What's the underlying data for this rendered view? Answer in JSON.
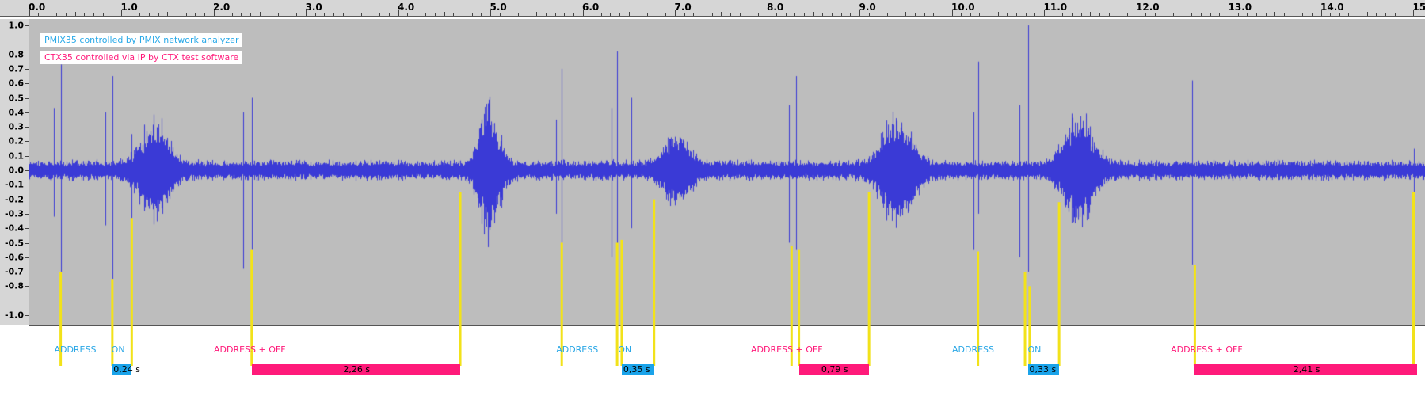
{
  "ruler": {
    "ticks": [
      "0.0",
      "1.0",
      "2.0",
      "3.0",
      "4.0",
      "5.0",
      "6.0",
      "7.0",
      "8.0",
      "9.0",
      "10.0",
      "11.0",
      "12.0",
      "13.0",
      "14.0",
      "15.0"
    ]
  },
  "amplitude_axis": {
    "labels": [
      "1.0",
      "0.8",
      "0.7",
      "0.6",
      "0.5",
      "0.4",
      "0.3",
      "0.2",
      "0.1",
      "0.0",
      "-0.1",
      "-0.2",
      "-0.3",
      "-0.4",
      "-0.5",
      "-0.6",
      "-0.7",
      "-0.8",
      "-1.0"
    ]
  },
  "legend": {
    "blue": "PMIX35 controlled by PMIX network analyzer",
    "pink": "CTX35 controlled via IP by CTX test software"
  },
  "colors": {
    "waveform": "#3a3ad6",
    "marker": "#f2e21a",
    "blue": "#1aa3ea",
    "pink": "#ff1a7a",
    "track": "#bdbdbd"
  },
  "annotations": [
    {
      "text": "ADDRESS",
      "color": "blue",
      "time": 0.27
    },
    {
      "text": "ON",
      "color": "blue",
      "time": 0.89
    },
    {
      "text": "ADDRESS + OFF",
      "color": "pink",
      "time": 2.0
    },
    {
      "text": "ADDRESS",
      "color": "blue",
      "time": 5.71
    },
    {
      "text": "ON",
      "color": "blue",
      "time": 6.38
    },
    {
      "text": "ADDRESS + OFF",
      "color": "pink",
      "time": 7.82
    },
    {
      "text": "ADDRESS",
      "color": "blue",
      "time": 10.0
    },
    {
      "text": "ON",
      "color": "blue",
      "time": 10.82
    },
    {
      "text": "ADDRESS + OFF",
      "color": "pink",
      "time": 12.37
    }
  ],
  "durations": [
    {
      "text": "0,24 s",
      "color": "blue",
      "start": 0.895,
      "end": 1.1
    },
    {
      "text": "2,26 s",
      "color": "pink",
      "start": 2.41,
      "end": 4.67
    },
    {
      "text": "0,35 s",
      "color": "blue",
      "start": 6.42,
      "end": 6.77
    },
    {
      "text": "0,79 s",
      "color": "pink",
      "start": 8.34,
      "end": 9.1
    },
    {
      "text": "0,33 s",
      "color": "blue",
      "start": 10.82,
      "end": 11.16
    },
    {
      "text": "2,41 s",
      "color": "pink",
      "start": 12.63,
      "end": 15.04
    }
  ],
  "markers": [
    {
      "time": 0.34,
      "amp": -0.7
    },
    {
      "time": 0.9,
      "amp": -0.75
    },
    {
      "time": 1.11,
      "amp": -0.33
    },
    {
      "time": 2.41,
      "amp": -0.55
    },
    {
      "time": 4.67,
      "amp": -0.15
    },
    {
      "time": 5.77,
      "amp": -0.5
    },
    {
      "time": 6.37,
      "amp": -0.5
    },
    {
      "time": 6.42,
      "amp": -0.48
    },
    {
      "time": 6.77,
      "amp": -0.2
    },
    {
      "time": 8.26,
      "amp": -0.52
    },
    {
      "time": 8.34,
      "amp": -0.55
    },
    {
      "time": 9.1,
      "amp": -0.15
    },
    {
      "time": 10.28,
      "amp": -0.56
    },
    {
      "time": 10.79,
      "amp": -0.7
    },
    {
      "time": 10.84,
      "amp": -0.8
    },
    {
      "time": 11.16,
      "amp": -0.22
    },
    {
      "time": 12.63,
      "amp": -0.65
    },
    {
      "time": 15.0,
      "amp": -0.15
    }
  ],
  "spikes": [
    {
      "time": 0.27,
      "pos": 0.43,
      "neg": 0.32
    },
    {
      "time": 0.34,
      "pos": 0.73,
      "neg": 0.7
    },
    {
      "time": 0.82,
      "pos": 0.4,
      "neg": 0.38
    },
    {
      "time": 0.9,
      "pos": 0.65,
      "neg": 0.75
    },
    {
      "time": 1.11,
      "pos": 0.25,
      "neg": 0.33
    },
    {
      "time": 2.32,
      "pos": 0.4,
      "neg": 0.68
    },
    {
      "time": 2.41,
      "pos": 0.5,
      "neg": 0.55
    },
    {
      "time": 5.71,
      "pos": 0.35,
      "neg": 0.3
    },
    {
      "time": 5.77,
      "pos": 0.7,
      "neg": 0.5
    },
    {
      "time": 6.31,
      "pos": 0.43,
      "neg": 0.6
    },
    {
      "time": 6.37,
      "pos": 0.82,
      "neg": 0.65
    },
    {
      "time": 6.52,
      "pos": 0.5,
      "neg": 0.4
    },
    {
      "time": 8.23,
      "pos": 0.45,
      "neg": 0.5
    },
    {
      "time": 8.31,
      "pos": 0.65,
      "neg": 0.55
    },
    {
      "time": 10.23,
      "pos": 0.4,
      "neg": 0.55
    },
    {
      "time": 10.28,
      "pos": 0.75,
      "neg": 0.3
    },
    {
      "time": 10.73,
      "pos": 0.45,
      "neg": 0.6
    },
    {
      "time": 10.82,
      "pos": 1.0,
      "neg": 0.7
    },
    {
      "time": 12.6,
      "pos": 0.62,
      "neg": 0.65
    },
    {
      "time": 15.0,
      "pos": 0.15,
      "neg": 0.15
    }
  ],
  "bursts": [
    {
      "center": 1.35,
      "width": 0.28,
      "amp": 0.3
    },
    {
      "center": 4.98,
      "width": 0.2,
      "amp": 0.42
    },
    {
      "center": 7.02,
      "width": 0.25,
      "amp": 0.22
    },
    {
      "center": 9.4,
      "width": 0.3,
      "amp": 0.34
    },
    {
      "center": 11.37,
      "width": 0.28,
      "amp": 0.35
    }
  ]
}
